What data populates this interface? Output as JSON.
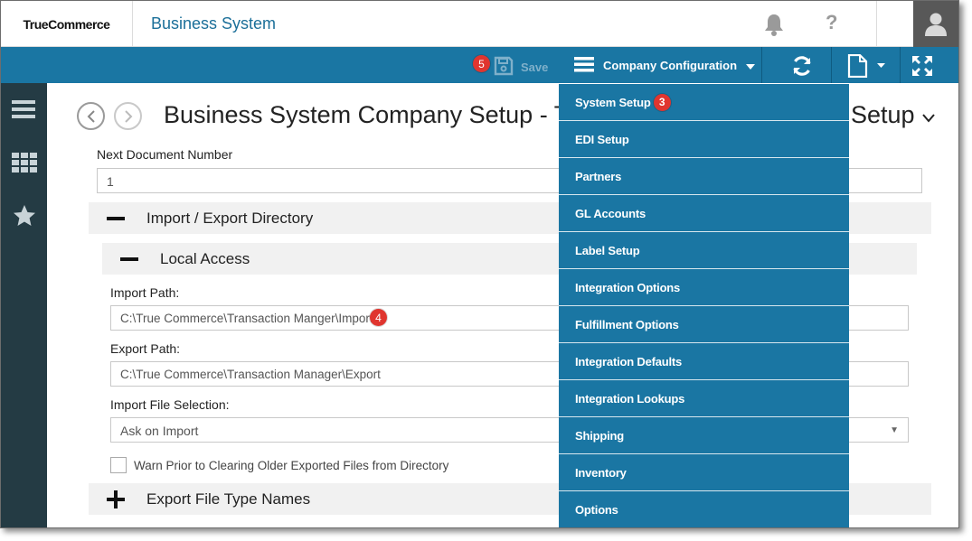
{
  "header": {
    "logo": "TrueCommerce",
    "app_title": "Business System"
  },
  "toolbar": {
    "save_badge": "5",
    "save_label": "Save",
    "menu_label": "Company Configuration"
  },
  "page": {
    "title": "Business System Company Setup - Tru",
    "title_end": "Setup"
  },
  "form": {
    "next_doc_label": "Next Document Number",
    "next_doc_value": "1",
    "import_export_section": "Import / Export Directory",
    "local_access_section": "Local Access",
    "import_path_label": "Import Path:",
    "import_path_value": "C:\\True Commerce\\Transaction Manger\\Import",
    "import_path_badge": "4",
    "export_path_label": "Export Path:",
    "export_path_value": "C:\\True Commerce\\Transaction Manager\\Export",
    "import_file_selection_label": "Import File Selection:",
    "import_file_selection_value": "Ask on Import",
    "warn_checkbox_label": "Warn Prior to Clearing Older Exported Files from Directory",
    "export_file_type_section": "Export File Type Names"
  },
  "menu": {
    "items": [
      {
        "label": "System Setup",
        "badge": "3"
      },
      {
        "label": "EDI Setup"
      },
      {
        "label": "Partners"
      },
      {
        "label": "GL Accounts"
      },
      {
        "label": "Label Setup"
      },
      {
        "label": "Integration Options"
      },
      {
        "label": "Fulfillment Options"
      },
      {
        "label": "Integration Defaults"
      },
      {
        "label": "Integration Lookups"
      },
      {
        "label": "Shipping"
      },
      {
        "label": "Inventory"
      },
      {
        "label": "Options"
      }
    ]
  },
  "colors": {
    "accent": "#1a76a3",
    "sidebar": "#243b44",
    "badge": "#e0352f"
  },
  "icons": [
    "bell-icon",
    "help-icon",
    "user-icon",
    "save-icon",
    "hamburger-icon",
    "refresh-icon",
    "document-icon",
    "expand-icon",
    "grid-icon",
    "star-icon",
    "back-icon",
    "forward-icon",
    "chevron-down-icon"
  ]
}
